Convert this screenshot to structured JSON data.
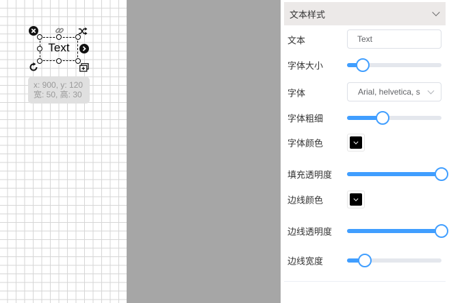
{
  "canvas": {
    "shape_text": "Text",
    "coords_line1": "x: 900, y: 120",
    "coords_line2": "宽: 50, 高: 30"
  },
  "panel": {
    "header_title": "文本样式",
    "text_label": "文本",
    "text_value": "Text",
    "font_size_label": "字体大小",
    "font_size_level": 0.17,
    "font_family_label": "字体",
    "font_family_value": "Arial, helvetica, s",
    "font_weight_label": "字体粗细",
    "font_weight_level": 0.38,
    "font_color_label": "字体颜色",
    "font_color": "#000000",
    "fill_opacity_label": "填充透明度",
    "fill_opacity_level": 1.0,
    "stroke_color_label": "边线颜色",
    "stroke_color": "#000000",
    "stroke_opacity_label": "边线透明度",
    "stroke_opacity_level": 1.0,
    "stroke_width_label": "边线宽度",
    "stroke_width_level": 0.19
  },
  "colors": {
    "accent": "#409eff",
    "gutter": "#a6a6a6",
    "header_bg": "#ece9e8"
  }
}
